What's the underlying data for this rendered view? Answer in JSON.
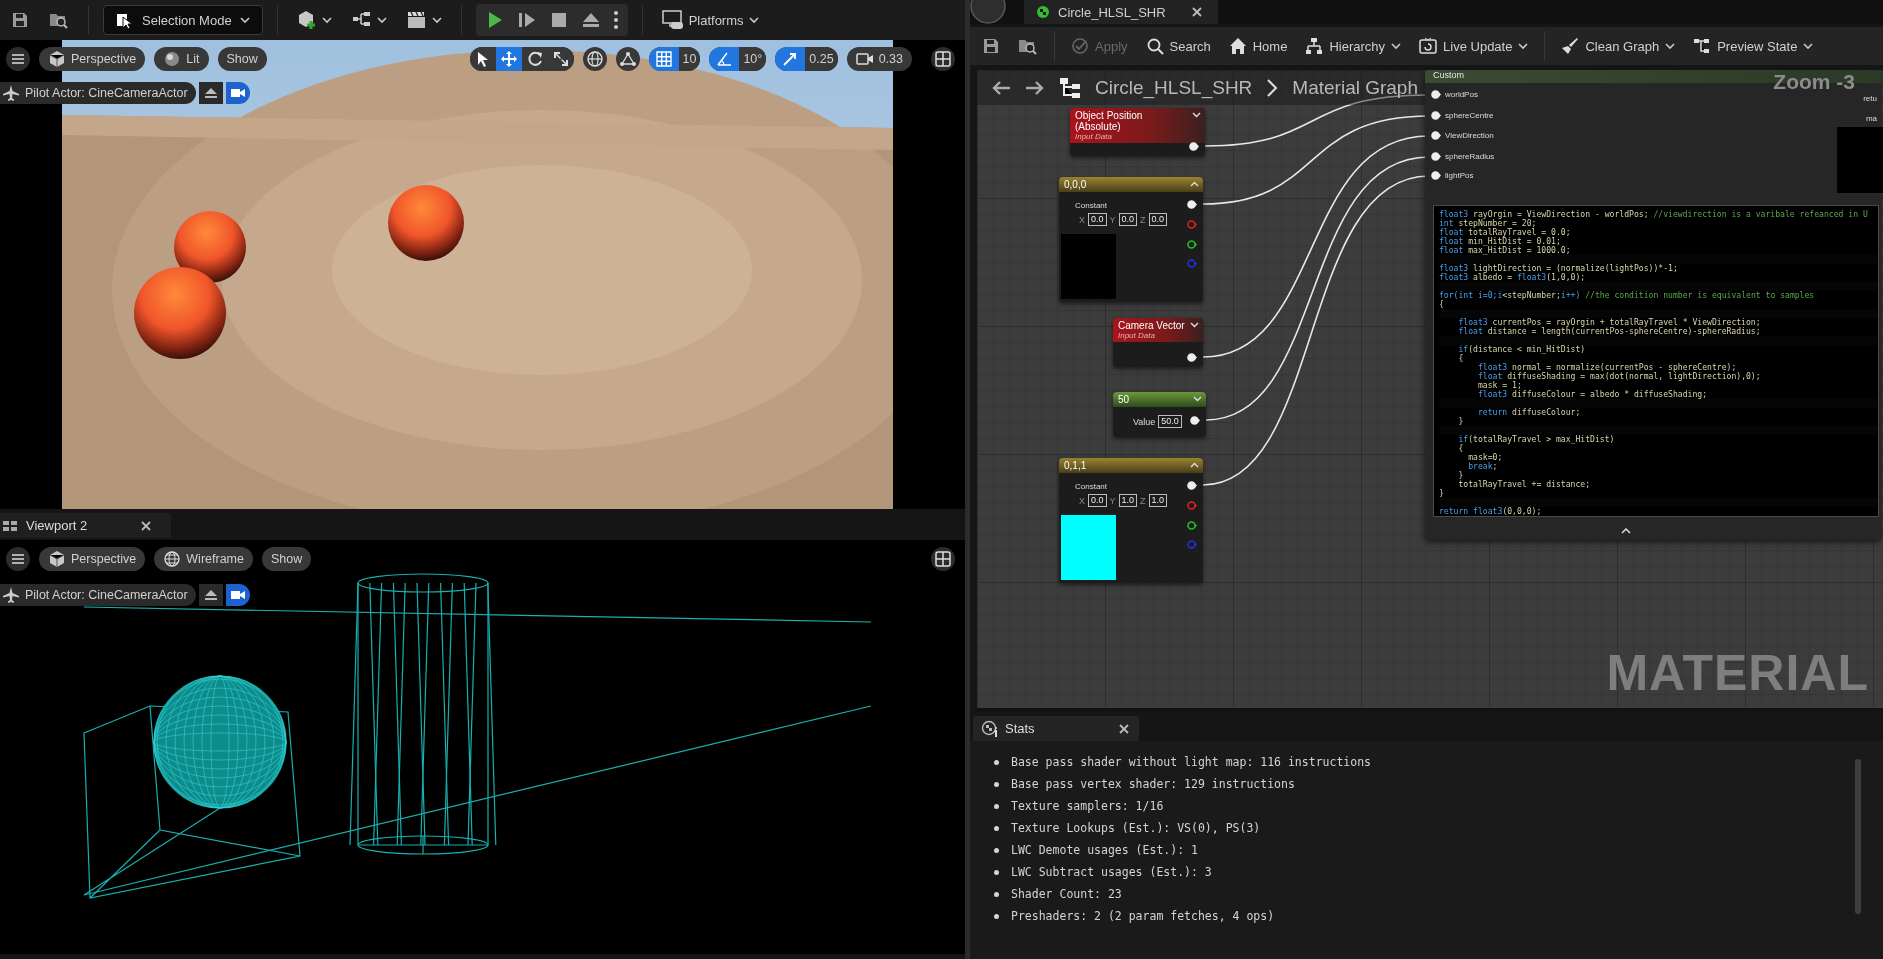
{
  "main_toolbar": {
    "mode_button": "Selection Mode",
    "platforms_button": "Platforms"
  },
  "viewports": [
    {
      "kind": "lit",
      "view_button": "Perspective",
      "mode_button": "Lit",
      "show_button": "Show",
      "transform_tools": [
        {
          "kind": "select",
          "selected": false
        },
        {
          "kind": "translate",
          "selected": true
        },
        {
          "kind": "rotate",
          "selected": false
        },
        {
          "kind": "scale",
          "selected": false
        }
      ],
      "snaps": [
        {
          "kind": "grid",
          "value": "10",
          "on": true
        },
        {
          "kind": "angle",
          "value": "10°",
          "on": true
        },
        {
          "kind": "scale",
          "value": "0.25",
          "on": true
        }
      ],
      "camera_speed": "0.33",
      "pilot_label": "Pilot Actor: CineCameraActor"
    },
    {
      "kind": "wireframe",
      "tab": "Viewport 2",
      "view_button": "Perspective",
      "mode_button": "Wireframe",
      "show_button": "Show",
      "pilot_label": "Pilot Actor: CineCameraActor"
    }
  ],
  "editor_tab": "Circle_HLSL_SHR",
  "editor_toolbar": [
    {
      "kind": "apply",
      "label": "Apply",
      "disabled": true,
      "dropdown": false
    },
    {
      "kind": "search",
      "label": "Search",
      "disabled": false,
      "dropdown": false
    },
    {
      "kind": "home",
      "label": "Home",
      "disabled": false,
      "dropdown": false
    },
    {
      "kind": "hierarchy",
      "label": "Hierarchy",
      "disabled": false,
      "dropdown": true
    },
    {
      "kind": "live_update",
      "label": "Live Update",
      "disabled": false,
      "dropdown": true
    },
    {
      "kind": "clean_graph",
      "label": "Clean Graph",
      "disabled": false,
      "dropdown": true
    },
    {
      "kind": "preview_state",
      "label": "Preview State",
      "disabled": false,
      "dropdown": true
    }
  ],
  "graph": {
    "breadcrumb": [
      "Circle_HLSL_SHR",
      "Material Graph"
    ],
    "zoom_label": "Zoom -3",
    "watermark": "MATERIAL",
    "nodes": [
      {
        "kind": "expression",
        "title": "Object Position (Absolute)",
        "subtitle": "Input Data",
        "expanded": false
      },
      {
        "kind": "constant3",
        "title": "0,0,0",
        "label": "Constant",
        "fields": [
          {
            "axis": "X",
            "value": "0.0"
          },
          {
            "axis": "Y",
            "value": "0.0"
          },
          {
            "axis": "Z",
            "value": "0.0"
          }
        ],
        "color": "#000000",
        "expanded": true
      },
      {
        "kind": "expression",
        "title": "Camera Vector",
        "subtitle": "Input Data",
        "expanded": false
      },
      {
        "kind": "scalar",
        "title": "50",
        "label": "Value",
        "value": "50.0",
        "expanded": false
      },
      {
        "kind": "constant3",
        "title": "0,1,1",
        "label": "Constant",
        "fields": [
          {
            "axis": "X",
            "value": "0.0"
          },
          {
            "axis": "Y",
            "value": "1.0"
          },
          {
            "axis": "Z",
            "value": "1.0"
          }
        ],
        "color": "#00ffff",
        "expanded": true
      }
    ],
    "custom_node": {
      "title": "Custom",
      "inputs": [
        "worldPos",
        "sphereCentre",
        "ViewDirection",
        "sphereRadius",
        "lightPos"
      ],
      "outputs": [
        "retu",
        "ma"
      ],
      "code_lines": [
        {
          "segments": [
            {
              "kind": "keyword",
              "text": "float3"
            },
            {
              "kind": "plain",
              "text": " rayOrgin = ViewDirection - worldPos; "
            },
            {
              "kind": "comment",
              "text": "//viewdirection is a varibale refeanced in U"
            }
          ]
        },
        {
          "segments": [
            {
              "kind": "keyword",
              "text": "int"
            },
            {
              "kind": "plain",
              "text": " stepNumber = 20;"
            }
          ]
        },
        {
          "segments": [
            {
              "kind": "keyword",
              "text": "float"
            },
            {
              "kind": "plain",
              "text": " totalRayTravel = 0.0;"
            }
          ]
        },
        {
          "segments": [
            {
              "kind": "keyword",
              "text": "float"
            },
            {
              "kind": "plain",
              "text": " min_HitDist = 0.01;"
            }
          ]
        },
        {
          "segments": [
            {
              "kind": "keyword",
              "text": "float"
            },
            {
              "kind": "plain",
              "text": " max_HitDist = 1000.0;"
            }
          ]
        },
        {
          "gap_before": true,
          "segments": [
            {
              "kind": "keyword",
              "text": "float3"
            },
            {
              "kind": "plain",
              "text": " lightDirection = (normalize(lightPos))*-1;"
            }
          ]
        },
        {
          "segments": [
            {
              "kind": "keyword",
              "text": "float3"
            },
            {
              "kind": "plain",
              "text": " albedo = "
            },
            {
              "kind": "keyword",
              "text": "float3"
            },
            {
              "kind": "plain",
              "text": "(1,0,0);"
            }
          ]
        },
        {
          "gap_before": true,
          "segments": [
            {
              "kind": "keyword",
              "text": "for(int i=0;i"
            },
            {
              "kind": "plain",
              "text": "<stepNumber;"
            },
            {
              "kind": "keyword",
              "text": "i++)"
            },
            {
              "kind": "comment",
              "text": " //the condition number is equivalent to samples"
            }
          ]
        },
        {
          "segments": [
            {
              "kind": "plain",
              "text": "{"
            }
          ]
        },
        {
          "gap_before": true,
          "segments": [
            {
              "kind": "keyword",
              "text": "    float3"
            },
            {
              "kind": "plain",
              "text": " currentPos = rayOrgin + totalRayTravel * ViewDirection;"
            }
          ]
        },
        {
          "segments": [
            {
              "kind": "keyword",
              "text": "    float"
            },
            {
              "kind": "plain",
              "text": " distance = length(currentPos-sphereCentre)-sphereRadius;"
            }
          ]
        },
        {
          "gap_before": true,
          "segments": [
            {
              "kind": "keyword",
              "text": "    if"
            },
            {
              "kind": "plain",
              "text": "(distance < min_HitDist)"
            }
          ]
        },
        {
          "segments": [
            {
              "kind": "plain",
              "text": "    {"
            }
          ]
        },
        {
          "segments": [
            {
              "kind": "keyword",
              "text": "        float3"
            },
            {
              "kind": "plain",
              "text": " normal = normalize(currentPos - sphereCentre);"
            }
          ]
        },
        {
          "segments": [
            {
              "kind": "keyword",
              "text": "        float"
            },
            {
              "kind": "plain",
              "text": " diffuseShading = max(dot(normal, lightDirection),0);"
            }
          ]
        },
        {
          "segments": [
            {
              "kind": "plain",
              "text": "        mask = 1;"
            }
          ]
        },
        {
          "segments": [
            {
              "kind": "keyword",
              "text": "        float3"
            },
            {
              "kind": "plain",
              "text": " diffuseColour = albedo * diffuseShading;"
            }
          ]
        },
        {
          "gap_before": true,
          "segments": [
            {
              "kind": "keyword",
              "text": "        return"
            },
            {
              "kind": "plain",
              "text": " diffuseColour;"
            }
          ]
        },
        {
          "segments": [
            {
              "kind": "plain",
              "text": "    }"
            }
          ]
        },
        {
          "gap_before": true,
          "segments": [
            {
              "kind": "keyword",
              "text": "    if"
            },
            {
              "kind": "plain",
              "text": "(totalRayTravel > max_HitDist)"
            }
          ]
        },
        {
          "segments": [
            {
              "kind": "plain",
              "text": "    {"
            }
          ]
        },
        {
          "segments": [
            {
              "kind": "plain",
              "text": "      mask=0;"
            }
          ]
        },
        {
          "segments": [
            {
              "kind": "keyword",
              "text": "      break"
            },
            {
              "kind": "plain",
              "text": ";"
            }
          ]
        },
        {
          "segments": [
            {
              "kind": "plain",
              "text": "    }"
            }
          ]
        },
        {
          "segments": [
            {
              "kind": "plain",
              "text": "    totalRayTravel += distance;"
            }
          ]
        },
        {
          "segments": [
            {
              "kind": "plain",
              "text": "}"
            }
          ]
        },
        {
          "gap_before": true,
          "segments": [
            {
              "kind": "keyword",
              "text": "return"
            },
            {
              "kind": "keyword",
              "text": " float3"
            },
            {
              "kind": "plain",
              "text": "(0,0,0);"
            }
          ]
        }
      ]
    }
  },
  "stats": {
    "tab": "Stats",
    "lines": [
      "Base pass shader without light map: 116 instructions",
      "Base pass vertex shader: 129 instructions",
      "Texture samplers: 1/16",
      "Texture Lookups (Est.): VS(0), PS(3)",
      "LWC Demote usages (Est.): 1",
      "LWC Subtract usages (Est.): 3",
      "Shader Count: 23",
      "Preshaders: 2  (2 param fetches, 4 ops)"
    ]
  }
}
